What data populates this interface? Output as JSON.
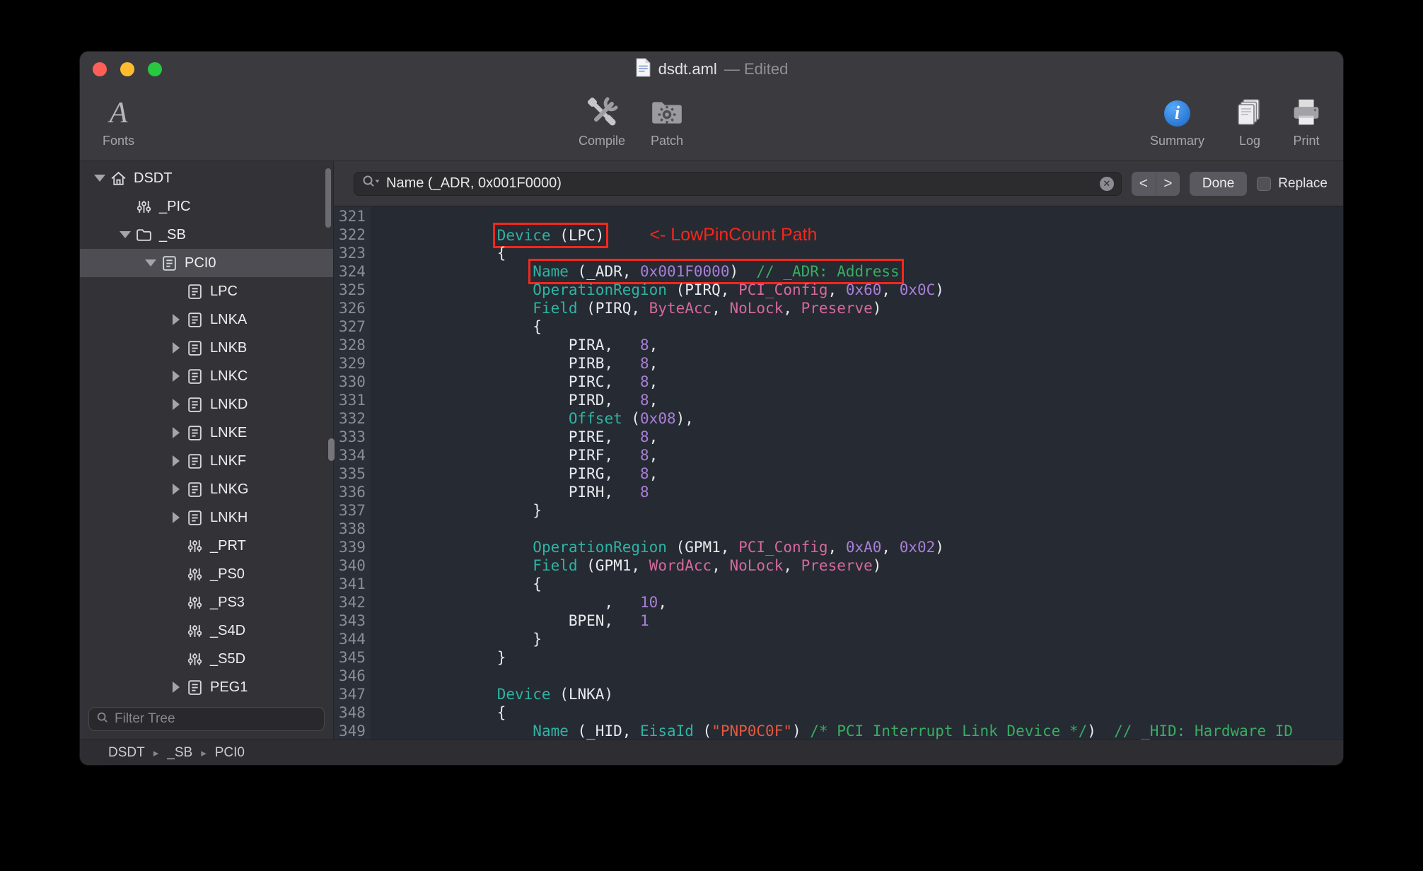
{
  "window": {
    "title": "dsdt.aml",
    "edited_suffix": "— Edited"
  },
  "toolbar": {
    "items": {
      "fonts": "Fonts",
      "compile": "Compile",
      "patch": "Patch",
      "summary": "Summary",
      "log": "Log",
      "print": "Print"
    }
  },
  "sidebar": {
    "filter_placeholder": "Filter Tree",
    "tree": [
      {
        "label": "DSDT",
        "depth": 0,
        "icon": "house",
        "disclosure": "down",
        "selected": false
      },
      {
        "label": "_PIC",
        "depth": 1,
        "icon": "mixer",
        "disclosure": "none",
        "selected": false
      },
      {
        "label": "_SB",
        "depth": 1,
        "icon": "folder",
        "disclosure": "down",
        "selected": false
      },
      {
        "label": "PCI0",
        "depth": 2,
        "icon": "device",
        "disclosure": "down",
        "selected": true
      },
      {
        "label": "LPC",
        "depth": 3,
        "icon": "device",
        "disclosure": "none",
        "selected": false
      },
      {
        "label": "LNKA",
        "depth": 3,
        "icon": "device",
        "disclosure": "right",
        "selected": false
      },
      {
        "label": "LNKB",
        "depth": 3,
        "icon": "device",
        "disclosure": "right",
        "selected": false
      },
      {
        "label": "LNKC",
        "depth": 3,
        "icon": "device",
        "disclosure": "right",
        "selected": false
      },
      {
        "label": "LNKD",
        "depth": 3,
        "icon": "device",
        "disclosure": "right",
        "selected": false
      },
      {
        "label": "LNKE",
        "depth": 3,
        "icon": "device",
        "disclosure": "right",
        "selected": false
      },
      {
        "label": "LNKF",
        "depth": 3,
        "icon": "device",
        "disclosure": "right",
        "selected": false
      },
      {
        "label": "LNKG",
        "depth": 3,
        "icon": "device",
        "disclosure": "right",
        "selected": false
      },
      {
        "label": "LNKH",
        "depth": 3,
        "icon": "device",
        "disclosure": "right",
        "selected": false
      },
      {
        "label": "_PRT",
        "depth": 3,
        "icon": "mixer",
        "disclosure": "none",
        "selected": false
      },
      {
        "label": "_PS0",
        "depth": 3,
        "icon": "mixer",
        "disclosure": "none",
        "selected": false
      },
      {
        "label": "_PS3",
        "depth": 3,
        "icon": "mixer",
        "disclosure": "none",
        "selected": false
      },
      {
        "label": "_S4D",
        "depth": 3,
        "icon": "mixer",
        "disclosure": "none",
        "selected": false
      },
      {
        "label": "_S5D",
        "depth": 3,
        "icon": "mixer",
        "disclosure": "none",
        "selected": false
      },
      {
        "label": "PEG1",
        "depth": 3,
        "icon": "device",
        "disclosure": "right",
        "selected": false
      }
    ]
  },
  "findbar": {
    "query": "Name (_ADR, 0x001F0000)",
    "prev_glyph": "<",
    "next_glyph": ">",
    "clear_glyph": "✕",
    "done_label": "Done",
    "replace_label": "Replace"
  },
  "breadcrumb": {
    "items": [
      "DSDT",
      "_SB",
      "PCI0"
    ],
    "separator": "▸"
  },
  "annotation": {
    "lpc_note": "<- LowPinCount Path"
  },
  "colors": {
    "keyword": "#2EB4A4",
    "number": "#A87FD8",
    "predefined": "#D4699F",
    "string": "#E05A41",
    "comment": "#38AD63",
    "plain": "#E8EAEE",
    "line_number": "#8A8E96",
    "annotation_red": "#F5271B",
    "traffic_red": "#FF5F57",
    "traffic_yellow": "#FEBC2E",
    "traffic_green": "#28C840"
  },
  "editor": {
    "lines": [
      {
        "num": "321",
        "segs": []
      },
      {
        "num": "322",
        "segs": [
          {
            "t": "            ",
            "c": "plain"
          },
          {
            "t": "Device",
            "c": "kw",
            "box": true
          },
          {
            "t": " (LPC)",
            "c": "plain",
            "box": true
          }
        ],
        "note": "lpc_note"
      },
      {
        "num": "323",
        "segs": [
          {
            "t": "            {",
            "c": "plain"
          }
        ]
      },
      {
        "num": "324",
        "segs": [
          {
            "t": "                ",
            "c": "plain"
          },
          {
            "t": "Name",
            "c": "kw",
            "box": true
          },
          {
            "t": " (_ADR, ",
            "c": "plain",
            "box": true
          },
          {
            "t": "0x001F0000",
            "c": "num",
            "box": true
          },
          {
            "t": ")  ",
            "c": "plain",
            "box": true
          },
          {
            "t": "// _ADR: Address",
            "c": "com",
            "box": true
          }
        ]
      },
      {
        "num": "325",
        "segs": [
          {
            "t": "                ",
            "c": "plain"
          },
          {
            "t": "OperationRegion",
            "c": "kw"
          },
          {
            "t": " (PIRQ, ",
            "c": "plain"
          },
          {
            "t": "PCI_Config",
            "c": "pre"
          },
          {
            "t": ", ",
            "c": "plain"
          },
          {
            "t": "0x60",
            "c": "num"
          },
          {
            "t": ", ",
            "c": "plain"
          },
          {
            "t": "0x0C",
            "c": "num"
          },
          {
            "t": ")",
            "c": "plain"
          }
        ]
      },
      {
        "num": "326",
        "segs": [
          {
            "t": "                ",
            "c": "plain"
          },
          {
            "t": "Field",
            "c": "kw"
          },
          {
            "t": " (PIRQ, ",
            "c": "plain"
          },
          {
            "t": "ByteAcc",
            "c": "pre"
          },
          {
            "t": ", ",
            "c": "plain"
          },
          {
            "t": "NoLock",
            "c": "pre"
          },
          {
            "t": ", ",
            "c": "plain"
          },
          {
            "t": "Preserve",
            "c": "pre"
          },
          {
            "t": ")",
            "c": "plain"
          }
        ]
      },
      {
        "num": "327",
        "segs": [
          {
            "t": "                {",
            "c": "plain"
          }
        ]
      },
      {
        "num": "328",
        "segs": [
          {
            "t": "                    PIRA,   ",
            "c": "plain"
          },
          {
            "t": "8",
            "c": "num"
          },
          {
            "t": ",",
            "c": "plain"
          }
        ]
      },
      {
        "num": "329",
        "segs": [
          {
            "t": "                    PIRB,   ",
            "c": "plain"
          },
          {
            "t": "8",
            "c": "num"
          },
          {
            "t": ",",
            "c": "plain"
          }
        ]
      },
      {
        "num": "330",
        "segs": [
          {
            "t": "                    PIRC,   ",
            "c": "plain"
          },
          {
            "t": "8",
            "c": "num"
          },
          {
            "t": ",",
            "c": "plain"
          }
        ]
      },
      {
        "num": "331",
        "segs": [
          {
            "t": "                    PIRD,   ",
            "c": "plain"
          },
          {
            "t": "8",
            "c": "num"
          },
          {
            "t": ",",
            "c": "plain"
          }
        ]
      },
      {
        "num": "332",
        "segs": [
          {
            "t": "                    ",
            "c": "plain"
          },
          {
            "t": "Offset",
            "c": "kw"
          },
          {
            "t": " (",
            "c": "plain"
          },
          {
            "t": "0x08",
            "c": "num"
          },
          {
            "t": "),",
            "c": "plain"
          }
        ]
      },
      {
        "num": "333",
        "segs": [
          {
            "t": "                    PIRE,   ",
            "c": "plain"
          },
          {
            "t": "8",
            "c": "num"
          },
          {
            "t": ",",
            "c": "plain"
          }
        ]
      },
      {
        "num": "334",
        "segs": [
          {
            "t": "                    PIRF,   ",
            "c": "plain"
          },
          {
            "t": "8",
            "c": "num"
          },
          {
            "t": ",",
            "c": "plain"
          }
        ]
      },
      {
        "num": "335",
        "segs": [
          {
            "t": "                    PIRG,   ",
            "c": "plain"
          },
          {
            "t": "8",
            "c": "num"
          },
          {
            "t": ",",
            "c": "plain"
          }
        ]
      },
      {
        "num": "336",
        "segs": [
          {
            "t": "                    PIRH,   ",
            "c": "plain"
          },
          {
            "t": "8",
            "c": "num"
          }
        ]
      },
      {
        "num": "337",
        "segs": [
          {
            "t": "                }",
            "c": "plain"
          }
        ]
      },
      {
        "num": "338",
        "segs": []
      },
      {
        "num": "339",
        "segs": [
          {
            "t": "                ",
            "c": "plain"
          },
          {
            "t": "OperationRegion",
            "c": "kw"
          },
          {
            "t": " (GPM1, ",
            "c": "plain"
          },
          {
            "t": "PCI_Config",
            "c": "pre"
          },
          {
            "t": ", ",
            "c": "plain"
          },
          {
            "t": "0xA0",
            "c": "num"
          },
          {
            "t": ", ",
            "c": "plain"
          },
          {
            "t": "0x02",
            "c": "num"
          },
          {
            "t": ")",
            "c": "plain"
          }
        ]
      },
      {
        "num": "340",
        "segs": [
          {
            "t": "                ",
            "c": "plain"
          },
          {
            "t": "Field",
            "c": "kw"
          },
          {
            "t": " (GPM1, ",
            "c": "plain"
          },
          {
            "t": "WordAcc",
            "c": "pre"
          },
          {
            "t": ", ",
            "c": "plain"
          },
          {
            "t": "NoLock",
            "c": "pre"
          },
          {
            "t": ", ",
            "c": "plain"
          },
          {
            "t": "Preserve",
            "c": "pre"
          },
          {
            "t": ")",
            "c": "plain"
          }
        ]
      },
      {
        "num": "341",
        "segs": [
          {
            "t": "                {",
            "c": "plain"
          }
        ]
      },
      {
        "num": "342",
        "segs": [
          {
            "t": "                        ,   ",
            "c": "plain"
          },
          {
            "t": "10",
            "c": "num"
          },
          {
            "t": ",",
            "c": "plain"
          }
        ]
      },
      {
        "num": "343",
        "segs": [
          {
            "t": "                    BPEN,   ",
            "c": "plain"
          },
          {
            "t": "1",
            "c": "num"
          }
        ]
      },
      {
        "num": "344",
        "segs": [
          {
            "t": "                }",
            "c": "plain"
          }
        ]
      },
      {
        "num": "345",
        "segs": [
          {
            "t": "            }",
            "c": "plain"
          }
        ]
      },
      {
        "num": "346",
        "segs": []
      },
      {
        "num": "347",
        "segs": [
          {
            "t": "            ",
            "c": "plain"
          },
          {
            "t": "Device",
            "c": "kw"
          },
          {
            "t": " (LNKA)",
            "c": "plain"
          }
        ]
      },
      {
        "num": "348",
        "segs": [
          {
            "t": "            {",
            "c": "plain"
          }
        ]
      },
      {
        "num": "349",
        "segs": [
          {
            "t": "                ",
            "c": "plain"
          },
          {
            "t": "Name",
            "c": "kw"
          },
          {
            "t": " (_HID, ",
            "c": "plain"
          },
          {
            "t": "EisaId",
            "c": "kw"
          },
          {
            "t": " (",
            "c": "plain"
          },
          {
            "t": "\"PNP0C0F\"",
            "c": "str"
          },
          {
            "t": ") ",
            "c": "plain"
          },
          {
            "t": "/* PCI Interrupt Link Device */",
            "c": "com"
          },
          {
            "t": ")  ",
            "c": "plain"
          },
          {
            "t": "// _HID: Hardware ID",
            "c": "com"
          }
        ]
      }
    ]
  }
}
